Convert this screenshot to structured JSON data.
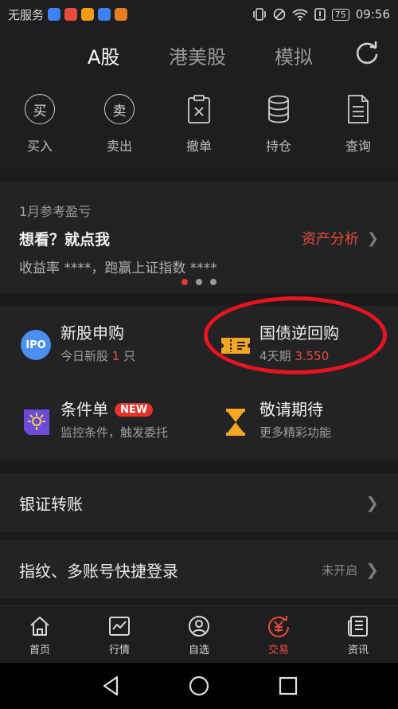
{
  "status_bar": {
    "carrier": "无服务",
    "battery": "75",
    "time": "09:56"
  },
  "top_tabs": [
    {
      "label": "A股",
      "active": true
    },
    {
      "label": "港美股",
      "active": false
    },
    {
      "label": "模拟",
      "active": false
    }
  ],
  "actions": [
    {
      "label": "买入",
      "glyph": "买",
      "icon": "buy-icon"
    },
    {
      "label": "卖出",
      "glyph": "卖",
      "icon": "sell-icon"
    },
    {
      "label": "撤单",
      "icon": "cancel-order-icon"
    },
    {
      "label": "持仓",
      "icon": "holdings-icon"
    },
    {
      "label": "查询",
      "icon": "query-icon"
    }
  ],
  "pnl_card": {
    "month": "1月参考盈亏",
    "title": "想看？就点我",
    "link": "资产分析",
    "desc": "收益率 ****，跑赢上证指数 ****",
    "dots": 3,
    "active_dot": 0
  },
  "features": {
    "ipo": {
      "title": "新股申购",
      "sub_prefix": "今日新股 ",
      "count": "1",
      "sub_suffix": " 只",
      "icon_text": "IPO"
    },
    "repo": {
      "title": "国债逆回购",
      "sub_prefix": "4天期 ",
      "rate": "3.550"
    },
    "condition": {
      "title": "条件单",
      "badge": "NEW",
      "sub": "监控条件，触发委托"
    },
    "coming": {
      "title": "敬请期待",
      "sub": "更多精彩功能"
    }
  },
  "rows": {
    "transfer": {
      "label": "银证转账"
    },
    "fingerprint": {
      "label": "指纹、多账号快捷登录",
      "status": "未开启"
    }
  },
  "bottom_nav": [
    {
      "label": "首页",
      "icon": "home-icon",
      "active": false
    },
    {
      "label": "行情",
      "icon": "market-icon",
      "active": false
    },
    {
      "label": "自选",
      "icon": "watchlist-icon",
      "active": false
    },
    {
      "label": "交易",
      "icon": "trade-icon",
      "active": true
    },
    {
      "label": "资讯",
      "icon": "news-icon",
      "active": false
    }
  ],
  "colors": {
    "accent": "#e94a3a",
    "highlight": "#e8141f",
    "background": "#1b1b1d",
    "card": "#232325",
    "ipo_blue": "#4b8ff0",
    "repo_orange": "#f5a623",
    "condition_purple": "#6a4bd8"
  }
}
